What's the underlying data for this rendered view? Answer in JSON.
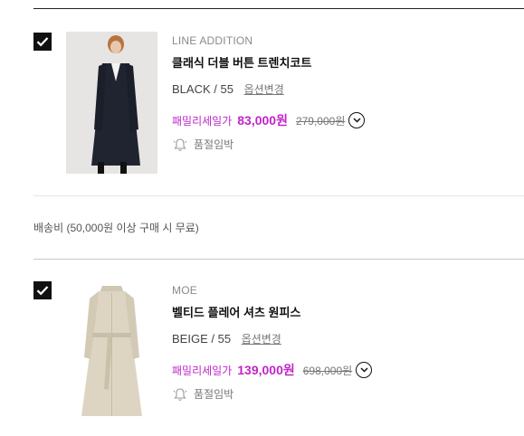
{
  "items": [
    {
      "brand": "LINE ADDITION",
      "name": "클래식 더블 버튼 트렌치코트",
      "color": "BLACK",
      "size": "55",
      "option_change": "옵션변경",
      "price_label": "패밀리세일가",
      "price": "83,000원",
      "original_price": "279,000원",
      "stock_status": "품절임박",
      "checked": true
    },
    {
      "brand": "MOE",
      "name": "벨티드 플레어 셔츠 원피스",
      "color": "BEIGE",
      "size": "55",
      "option_change": "옵션변경",
      "price_label": "패밀리세일가",
      "price": "139,000원",
      "original_price": "698,000원",
      "stock_status": "품절임박",
      "checked": true
    }
  ],
  "shipping_note": "배송비 (50,000원 이상 구매 시 무료)",
  "colors": {
    "accent": "#c026c9",
    "text": "#111111",
    "muted": "#777777"
  }
}
